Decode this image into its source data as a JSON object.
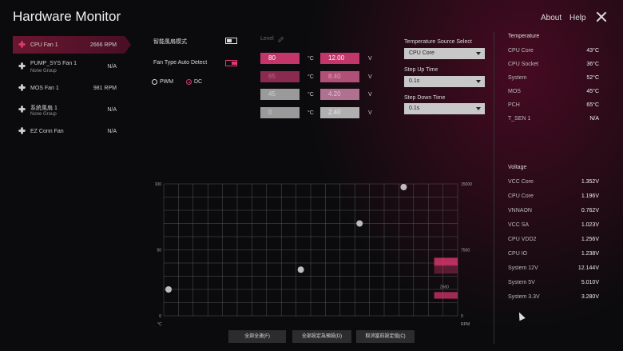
{
  "app": {
    "title": "Hardware Monitor",
    "nav_about": "About",
    "nav_help": "Help"
  },
  "fans": [
    {
      "name": "CPU Fan 1",
      "sub": "",
      "rpm": "2666 RPM",
      "active": true
    },
    {
      "name": "PUMP_SYS Fan 1",
      "sub": "None Group",
      "rpm": "N/A",
      "active": false
    },
    {
      "name": "MOS Fan 1",
      "sub": "",
      "rpm": "981 RPM",
      "active": false
    },
    {
      "name": "系統風扇 1",
      "sub": "None Group",
      "rpm": "N/A",
      "active": false
    },
    {
      "name": "EZ Conn Fan",
      "sub": "",
      "rpm": "N/A",
      "active": false
    }
  ],
  "controls": {
    "smart_mode_label": "智能風扇模式",
    "auto_detect_label": "Fan Type Auto Detect",
    "pwm_label": "PWM",
    "dc_label": "DC",
    "level_label": "Level"
  },
  "levels": [
    {
      "temp": "80",
      "temp_unit": "°C",
      "volt": "12.00",
      "volt_unit": "V"
    },
    {
      "temp": "65",
      "temp_unit": "°C",
      "volt": "8.40",
      "volt_unit": "V"
    },
    {
      "temp": "45",
      "temp_unit": "°C",
      "volt": "4.20",
      "volt_unit": "V"
    },
    {
      "temp": "0",
      "temp_unit": "°C",
      "volt": "2.40",
      "volt_unit": "V"
    }
  ],
  "source": {
    "temp_source_label": "Temperature Source Select",
    "temp_source_value": "CPU Core",
    "step_up_label": "Step Up Time",
    "step_up_value": "0.1s",
    "step_down_label": "Step Down Time",
    "step_down_value": "0.1s"
  },
  "temperature": {
    "title": "Temperature",
    "rows": [
      {
        "name": "CPU Core",
        "value": "43°C"
      },
      {
        "name": "CPU Socket",
        "value": "36°C"
      },
      {
        "name": "System",
        "value": "52°C"
      },
      {
        "name": "MOS",
        "value": "45°C"
      },
      {
        "name": "PCH",
        "value": "65°C"
      },
      {
        "name": "T_SEN 1",
        "value": "N/A"
      }
    ]
  },
  "voltage": {
    "title": "Voltage",
    "rows": [
      {
        "name": "VCC Core",
        "value": "1.352V"
      },
      {
        "name": "CPU Core",
        "value": "1.196V"
      },
      {
        "name": "VNNAON",
        "value": "0.762V"
      },
      {
        "name": "VCC SA",
        "value": "1.023V"
      },
      {
        "name": "CPU VDD2",
        "value": "1.256V"
      },
      {
        "name": "CPU IO",
        "value": "1.238V"
      },
      {
        "name": "System 12V",
        "value": "12.144V"
      },
      {
        "name": "System 5V",
        "value": "5.010V"
      },
      {
        "name": "System 3.3V",
        "value": "3.280V"
      }
    ]
  },
  "chart_data": {
    "type": "scatter",
    "x_unit": "°C",
    "y_left_ticks": [
      "100",
      "50",
      "0"
    ],
    "y_right_ticks": [
      "15000",
      "7500",
      "0"
    ],
    "y_right_unit": "RPM",
    "xlim": [
      0,
      100
    ],
    "ylim": [
      0,
      100
    ],
    "points": [
      {
        "x": 0,
        "y": 20
      },
      {
        "x": 45,
        "y": 35
      },
      {
        "x": 65,
        "y": 70
      },
      {
        "x": 80,
        "y": 100
      }
    ],
    "rpm_label": "2660",
    "colors": {
      "accent": "#e0386f",
      "grid": "#555555"
    }
  },
  "buttons": {
    "full_speed": "全部全速(F)",
    "set_default": "全部設定為預設(D)",
    "cancel": "取消當前設定值(C)"
  }
}
